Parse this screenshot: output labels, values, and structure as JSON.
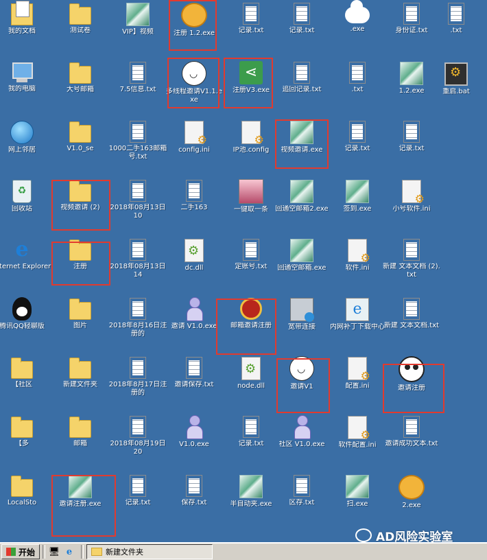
{
  "desktop": {
    "c1": [
      {
        "label": "我的文档",
        "icon": "my-documents-icon"
      },
      {
        "label": "我的电脑",
        "icon": "my-computer-icon"
      },
      {
        "label": "网上邻居",
        "icon": "network-places-icon"
      },
      {
        "label": "回收站",
        "icon": "recycle-bin-icon"
      },
      {
        "label": "Internet Explorer",
        "icon": "internet-explorer-icon"
      },
      {
        "label": "腾讯QQ轻聊版",
        "icon": "qq-icon"
      },
      {
        "label": "【社区",
        "icon": "folder-icon"
      },
      {
        "label": "【多",
        "icon": "folder-icon"
      },
      {
        "label": "LocalSto",
        "icon": "folder-icon"
      }
    ],
    "c2": [
      {
        "label": "测试卷",
        "icon": "folder-icon"
      },
      {
        "label": "大号邮箱",
        "icon": "folder-icon"
      },
      {
        "label": "V1.0_se",
        "icon": "folder-icon"
      },
      {
        "label": "视频邀请 (2)",
        "icon": "folder-icon"
      },
      {
        "label": "注册",
        "icon": "folder-icon"
      },
      {
        "label": "图片",
        "icon": "folder-icon"
      },
      {
        "label": "新建文件夹",
        "icon": "folder-icon"
      },
      {
        "label": "邮箱",
        "icon": "folder-icon"
      },
      {
        "label": "邀请注册.exe",
        "icon": "exe-icon"
      }
    ],
    "c3": [
      {
        "label": "VIP】视频",
        "icon": "exe-icon"
      },
      {
        "label": "7.5信息.txt",
        "icon": "text-file-icon"
      },
      {
        "label": "1000二手163邮箱号.txt",
        "icon": "text-file-icon"
      },
      {
        "label": "2018年08月13日 10",
        "icon": "text-file-icon"
      },
      {
        "label": "2018年08月13日 14",
        "icon": "text-file-icon"
      },
      {
        "label": "2018年8月16日注册的",
        "icon": "text-file-icon"
      },
      {
        "label": "2018年8月17日注册的",
        "icon": "text-file-icon"
      },
      {
        "label": "2018年08月19日 20",
        "icon": "text-file-icon"
      },
      {
        "label": "记录.txt",
        "icon": "text-file-icon"
      }
    ],
    "c4": [
      {
        "label": "注册 1.2.exe",
        "icon": "bear-icon"
      },
      {
        "label": "多线程邀请V1.1.exe",
        "icon": "smiley-icon"
      },
      {
        "label": "config.ini",
        "icon": "config-file-icon"
      },
      {
        "label": "二手163",
        "icon": "text-file-icon"
      },
      {
        "label": "dc.dll",
        "icon": "dll-icon"
      },
      {
        "label": "邀请 V1.0.exe",
        "icon": "person-icon"
      },
      {
        "label": "邀请保存.txt",
        "icon": "text-file-icon"
      },
      {
        "label": "V1.0.exe",
        "icon": "person-icon"
      },
      {
        "label": "保存.txt",
        "icon": "text-file-icon"
      }
    ],
    "c5": [
      {
        "label": "记录.txt",
        "icon": "text-file-icon"
      },
      {
        "label": "注册V3.exe",
        "icon": "share-icon"
      },
      {
        "label": "IP池.config",
        "icon": "config-file-icon"
      },
      {
        "label": "一键取一条",
        "icon": "anime-icon"
      },
      {
        "label": "定账号.txt",
        "icon": "text-file-icon"
      },
      {
        "label": "邮箱邀请注册",
        "icon": "red-badge-icon"
      },
      {
        "label": "node.dll",
        "icon": "dll-icon"
      },
      {
        "label": "记录.txt",
        "icon": "text-file-icon"
      },
      {
        "label": "半自动夹.exe",
        "icon": "exe-icon"
      }
    ],
    "c6": [
      {
        "label": "记录.txt",
        "icon": "text-file-icon"
      },
      {
        "label": "追回记录.txt",
        "icon": "text-file-icon"
      },
      {
        "label": "视频邀请.exe",
        "icon": "exe-icon"
      },
      {
        "label": "回通空邮箱2.exe",
        "icon": "exe-icon"
      },
      {
        "label": "回通空邮箱.exe",
        "icon": "exe-icon"
      },
      {
        "label": "宽带连接",
        "icon": "broadband-icon"
      },
      {
        "label": "邀请V1",
        "icon": "smiley-icon"
      },
      {
        "label": "社区 V1.0.exe",
        "icon": "person-icon"
      },
      {
        "label": "区存.txt",
        "icon": "text-file-icon"
      }
    ],
    "c7": [
      {
        "label": ".exe",
        "icon": "cloud-icon"
      },
      {
        "label": ".txt",
        "icon": "text-file-icon"
      },
      {
        "label": "记录.txt",
        "icon": "text-file-icon"
      },
      {
        "label": "签到.exe",
        "icon": "exe-icon"
      },
      {
        "label": "软件.ini",
        "icon": "config-file-icon"
      },
      {
        "label": "内网补丁下载中心",
        "icon": "ie-download-icon"
      },
      {
        "label": "配置.ini",
        "icon": "config-file-icon"
      },
      {
        "label": "软件配置.ini",
        "icon": "config-file-icon"
      },
      {
        "label": "扫.exe",
        "icon": "exe-icon"
      }
    ],
    "c8": [
      {
        "label": "身份证.txt",
        "icon": "text-file-icon"
      },
      {
        "label": "1.2.exe",
        "icon": "exe-icon"
      },
      {
        "label": "记录.txt",
        "icon": "text-file-icon"
      },
      {
        "label": "小号软件.ini",
        "icon": "config-file-icon"
      },
      {
        "label": "新建 文本文档 (2).txt",
        "icon": "text-file-icon"
      },
      {
        "label": "新建 文本文档.txt",
        "icon": "text-file-icon"
      },
      {
        "label": "邀请注册",
        "icon": "panda-icon"
      },
      {
        "label": "邀请成功文本.txt",
        "icon": "text-file-icon"
      },
      {
        "label": "2.exe",
        "icon": "bear-icon"
      }
    ],
    "c9": [
      {
        "label": ".txt",
        "icon": "text-file-icon"
      },
      {
        "label": "重启.bat",
        "icon": "batch-file-icon"
      }
    ]
  },
  "taskbar": {
    "start_label": "开始",
    "window_button_label": "新建文件夹"
  },
  "watermark": {
    "text": "AD风险实验室"
  },
  "colors": {
    "desktop_bg": "#3a6ea5",
    "highlight": "#e23a2e"
  }
}
